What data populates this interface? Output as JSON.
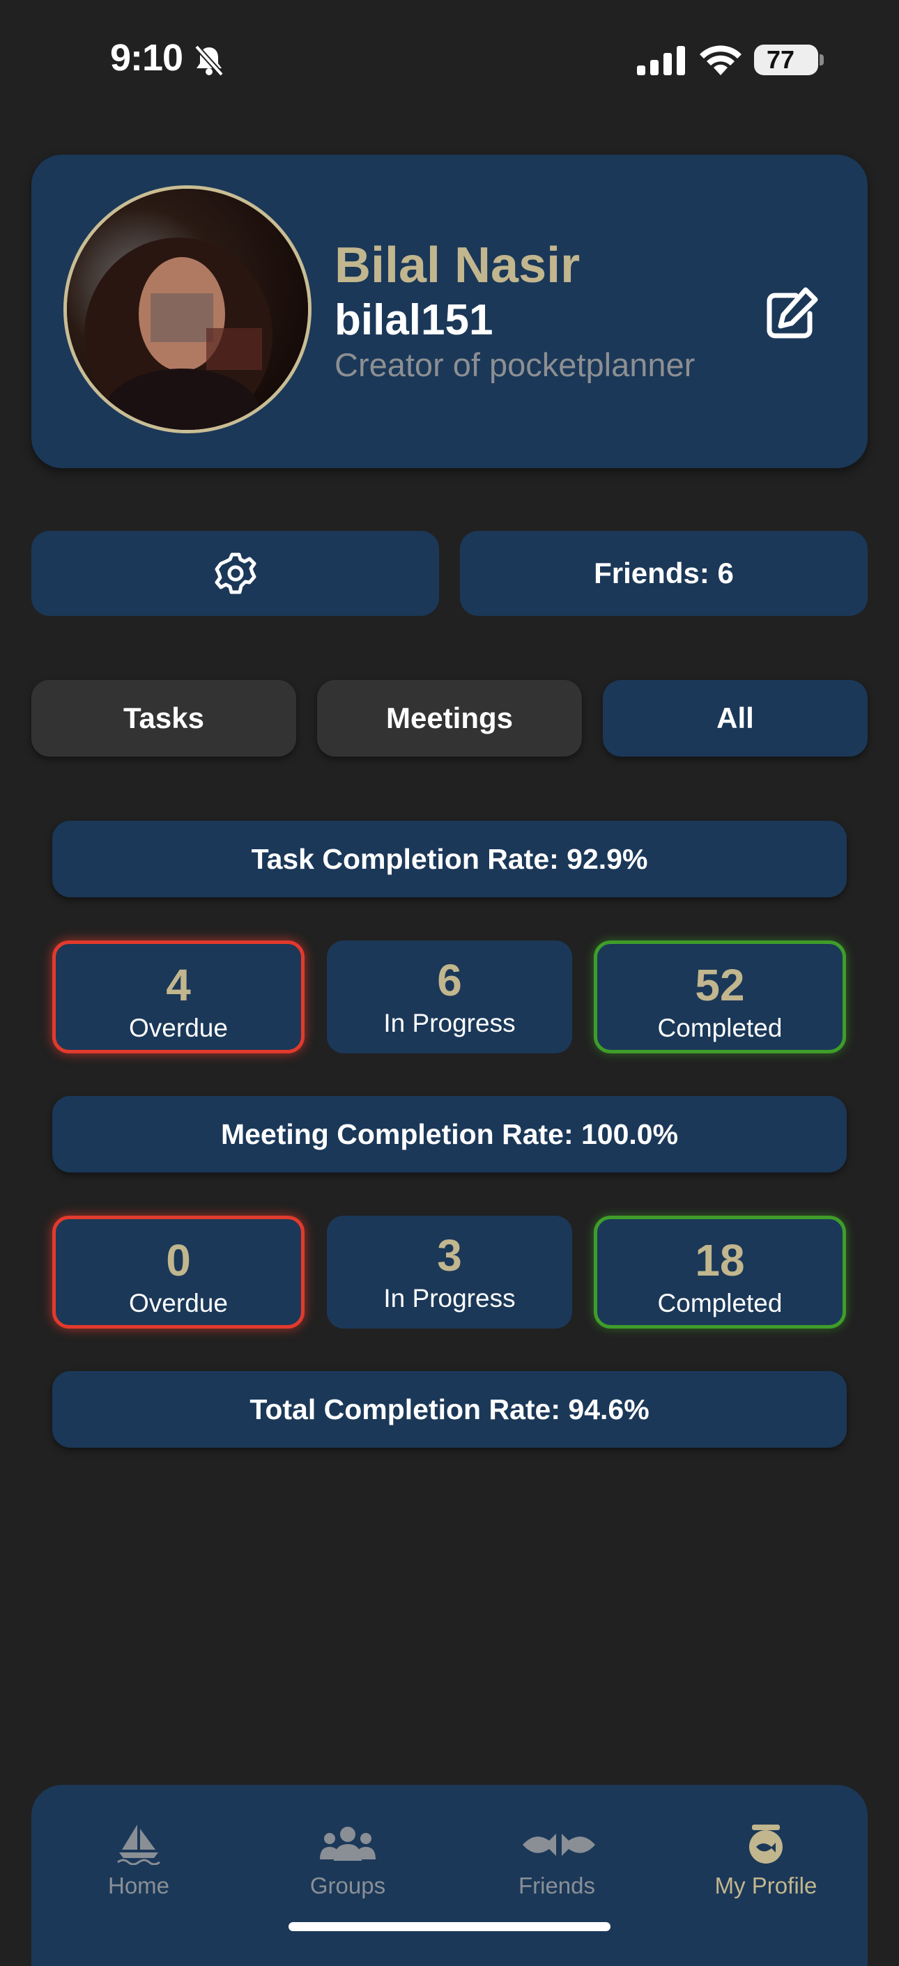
{
  "status_bar": {
    "time": "9:10",
    "battery": "77",
    "icons": [
      "bell-slash-icon",
      "signal-icon",
      "wifi-icon",
      "battery-icon"
    ]
  },
  "profile": {
    "name": "Bilal Nasir",
    "username": "bilal151",
    "bio": "Creator of pocketplanner",
    "avatar": "profile-photo",
    "edit_icon": "edit-icon"
  },
  "actions": {
    "settings_icon": "gear-icon",
    "friends_label": "Friends: 6"
  },
  "tabs": [
    {
      "label": "Tasks",
      "selected": false
    },
    {
      "label": "Meetings",
      "selected": false
    },
    {
      "label": "All",
      "selected": true
    }
  ],
  "tasks": {
    "rate": "Task Completion Rate: 92.9%",
    "overdue": {
      "count": "4",
      "label": "Overdue"
    },
    "in_progress": {
      "count": "6",
      "label": "In Progress"
    },
    "completed": {
      "count": "52",
      "label": "Completed"
    }
  },
  "meetings": {
    "rate": "Meeting Completion Rate: 100.0%",
    "overdue": {
      "count": "0",
      "label": "Overdue"
    },
    "in_progress": {
      "count": "3",
      "label": "In Progress"
    },
    "completed": {
      "count": "18",
      "label": "Completed"
    }
  },
  "total": {
    "rate": "Total Completion Rate: 94.6%"
  },
  "nav": [
    {
      "label": "Home",
      "icon": "sailboat-icon"
    },
    {
      "label": "Groups",
      "icon": "users-icon"
    },
    {
      "label": "Friends",
      "icon": "fish-icon"
    },
    {
      "label": "My Profile",
      "icon": "fishbowl-icon"
    }
  ],
  "colors": {
    "background": "#212121",
    "card": "#1b3858",
    "accent_gold": "#c2b68e",
    "overdue_red": "#e23a2c",
    "completed_green": "#3f9d2a",
    "tab_inactive": "#333333"
  }
}
